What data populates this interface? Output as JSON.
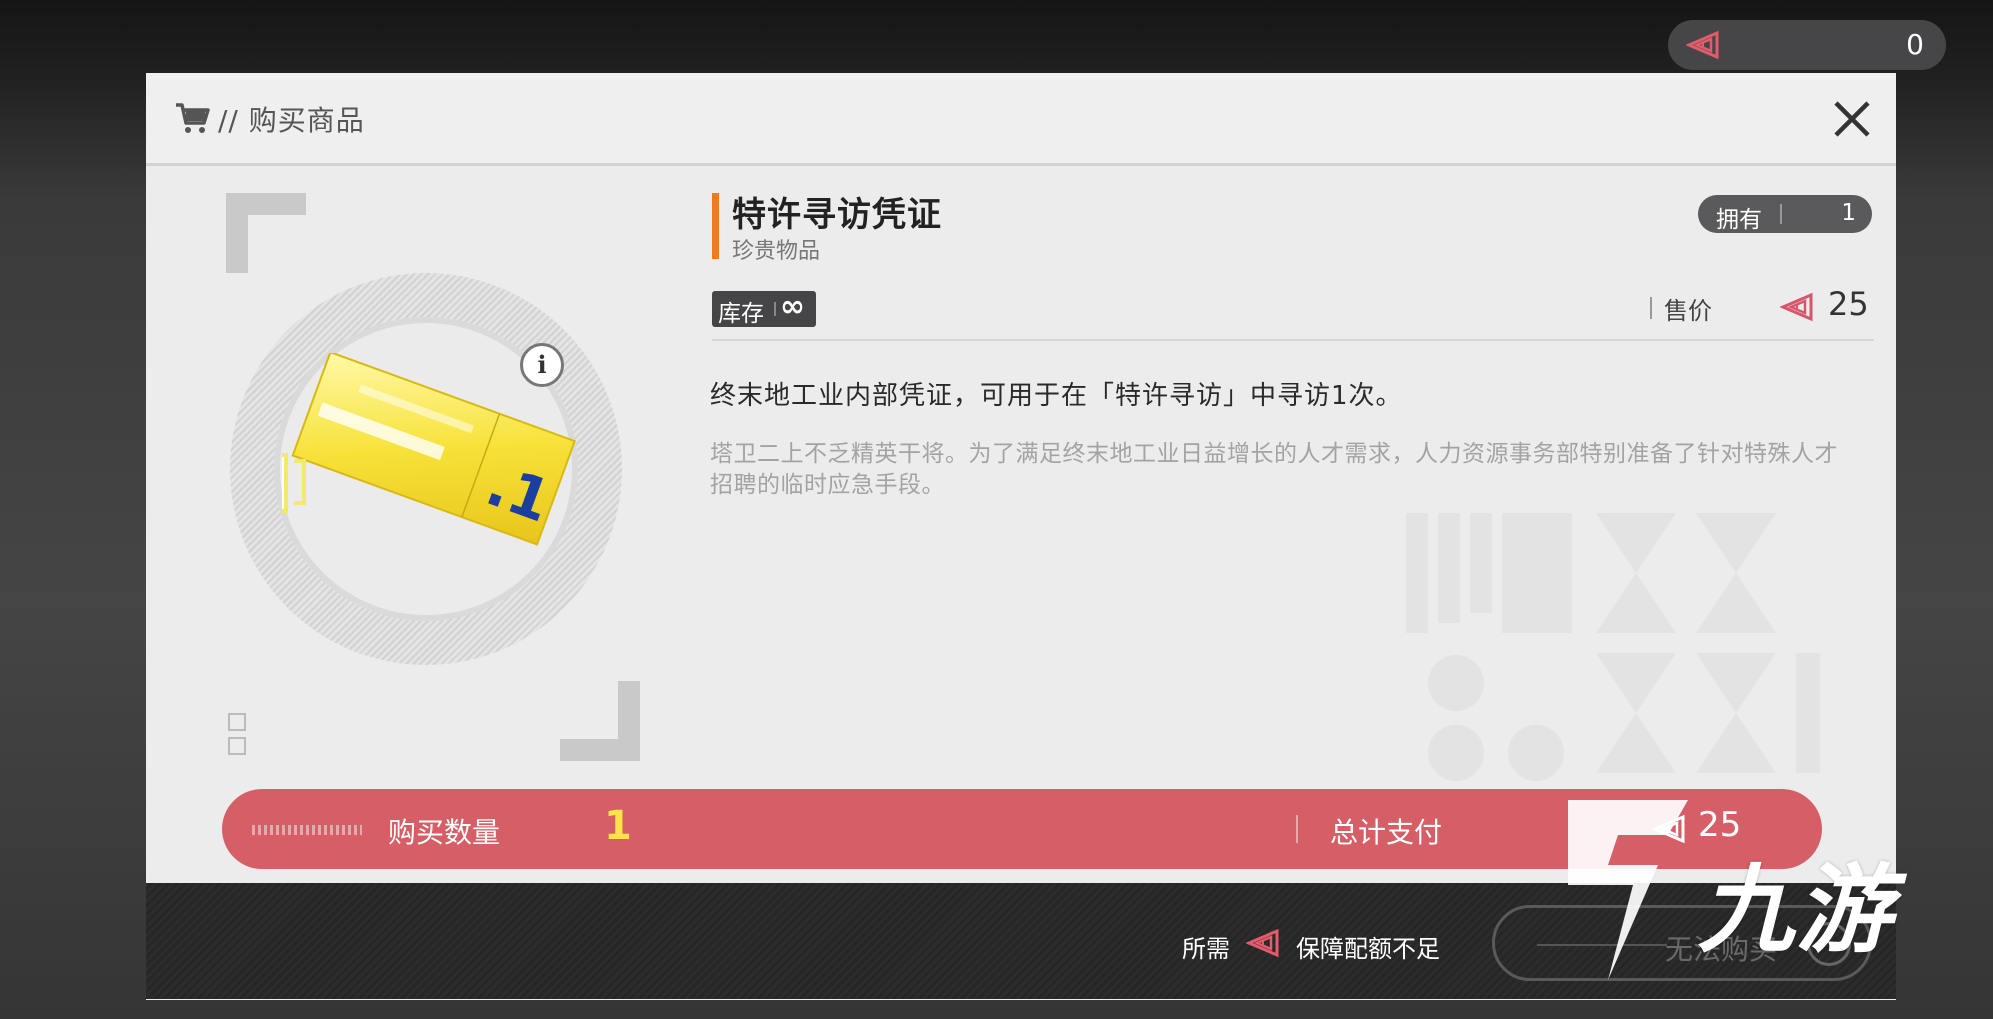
{
  "top_bar": {
    "currency_icon": "triangle-token-icon",
    "currency_amount": "0"
  },
  "dialog": {
    "header_title": "// 购买商品",
    "close_icon": "close-icon"
  },
  "item": {
    "name": "特许寻访凭证",
    "category": "珍贵物品",
    "owned_label": "拥有",
    "owned_value": "1",
    "stock_label": "库存",
    "stock_value": "∞",
    "price_label": "售价",
    "price_value": "25",
    "description": "终末地工业内部凭证，可用于在「特许寻访」中寻访1次。",
    "flavor_text": "塔卫二上不乏精英干将。为了满足终末地工业日益增长的人才需求，人力资源事务部特别准备了针对特殊人才招聘的临时应急手段。",
    "ticket_mark": ".1",
    "accent_color": "#f07a1c"
  },
  "purchase_bar": {
    "quantity_label": "购买数量",
    "quantity_value": "1",
    "total_label": "总计支付",
    "total_value": "25",
    "bar_color": "#d65f67"
  },
  "footer": {
    "required_label": "所需",
    "required_status": "保障配额不足",
    "button_label": "无法购买"
  },
  "watermark_logo": {
    "text": "九游"
  }
}
